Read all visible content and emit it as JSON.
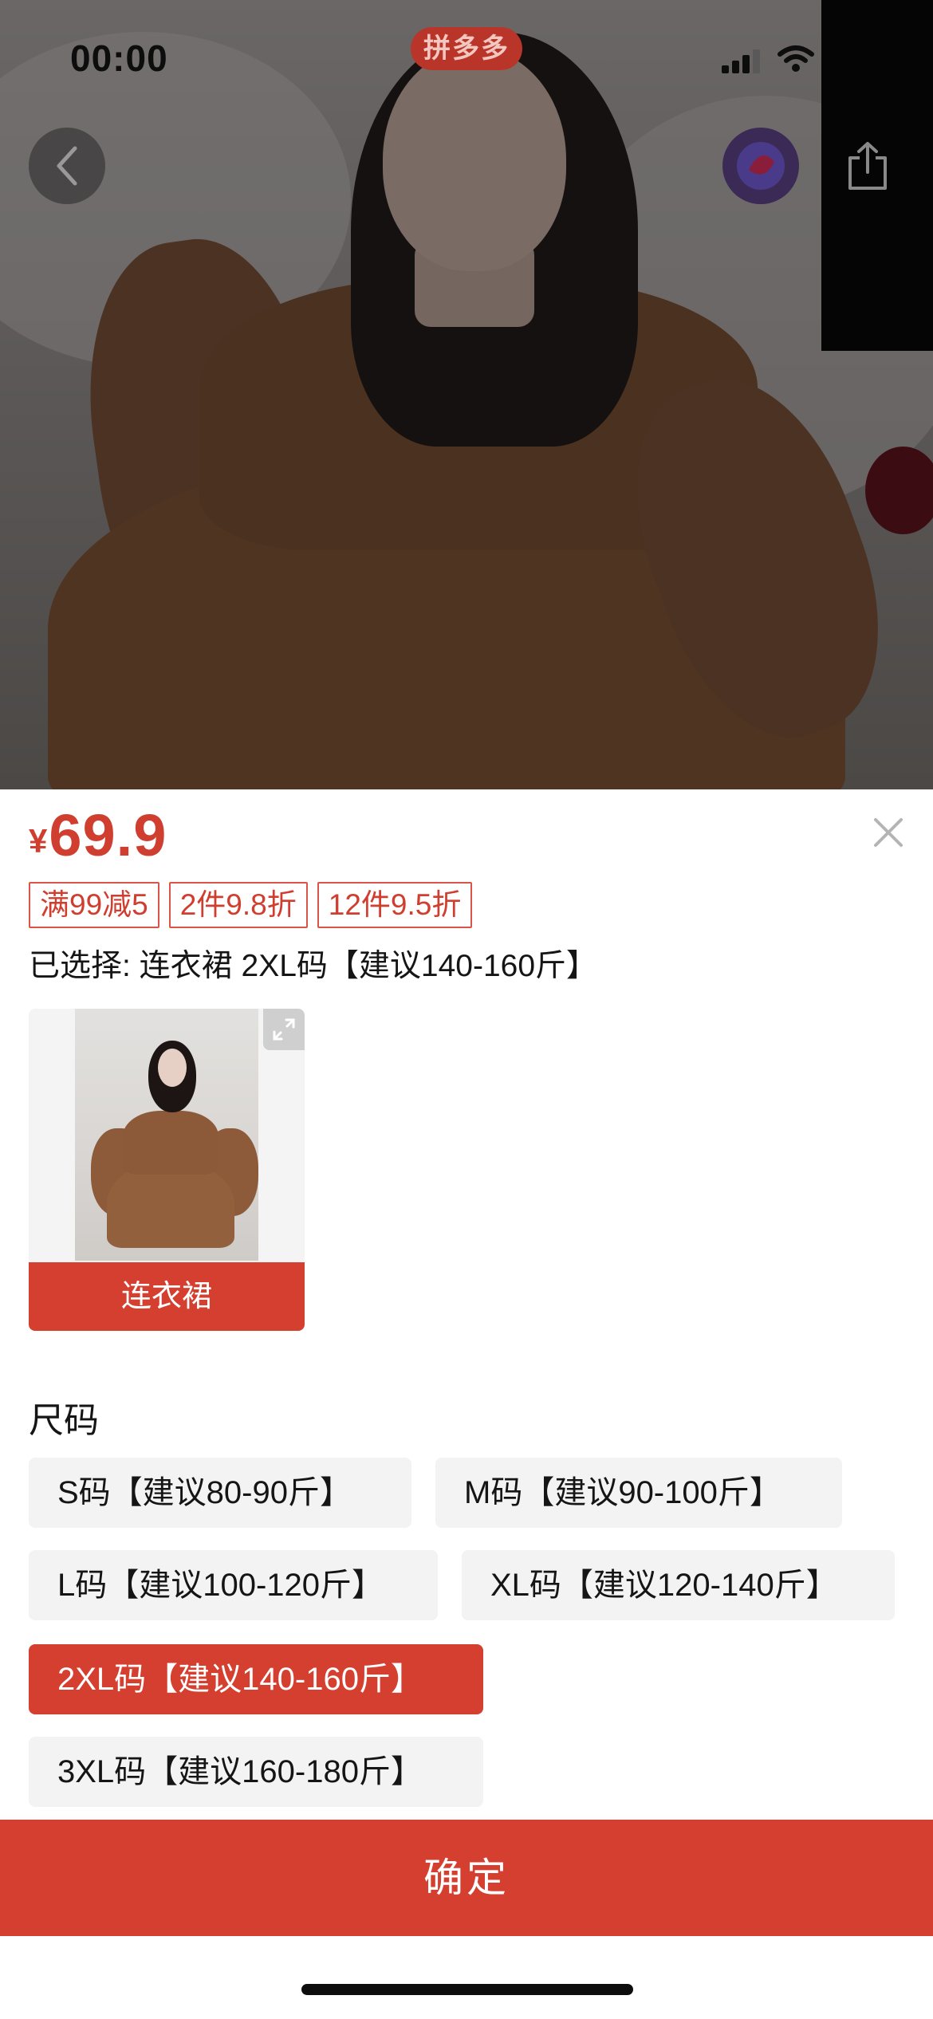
{
  "status_bar": {
    "time": "00:00"
  },
  "header": {
    "brand_badge": "拼多多"
  },
  "product": {
    "currency": "¥",
    "price": "69.9",
    "promos": [
      "满99减5",
      "2件9.8折",
      "12件9.5折"
    ],
    "selected_summary": "已选择: 连衣裙 2XL码【建议140-160斤】"
  },
  "style_options": [
    {
      "label": "连衣裙",
      "selected": true
    }
  ],
  "size_section": {
    "title": "尺码",
    "options": [
      {
        "label": "S码【建议80-90斤】",
        "selected": false
      },
      {
        "label": "M码【建议90-100斤】",
        "selected": false
      },
      {
        "label": "L码【建议100-120斤】",
        "selected": false
      },
      {
        "label": "XL码【建议120-140斤】",
        "selected": false
      },
      {
        "label": "2XL码【建议140-160斤】",
        "selected": true
      },
      {
        "label": "3XL码【建议160-180斤】",
        "selected": false
      }
    ]
  },
  "footer": {
    "confirm_label": "确定"
  },
  "colors": {
    "accent": "#d43f30",
    "price": "#cf3e2e",
    "option_bg": "#f3f3f3"
  },
  "icons": [
    "back-arrow-icon",
    "share-icon",
    "close-icon",
    "expand-icon",
    "signal-icon",
    "wifi-icon"
  ]
}
